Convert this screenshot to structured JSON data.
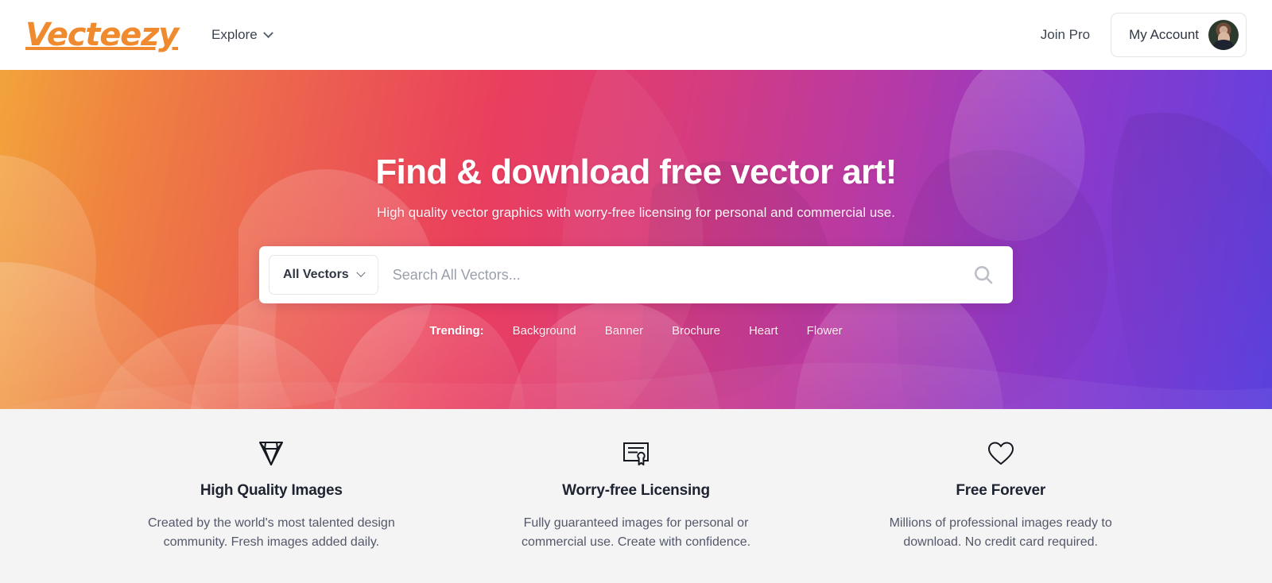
{
  "brand": {
    "logo_text": "Vecteezy",
    "logo_color": "#f08a2e"
  },
  "header": {
    "explore_label": "Explore",
    "join_pro_label": "Join Pro",
    "account_label": "My Account"
  },
  "hero": {
    "title": "Find & download free vector art!",
    "subtitle": "High quality vector graphics with worry-free licensing for personal and commercial use.",
    "gradient_from": "#f2a33c",
    "gradient_mid": "#ea3e5e",
    "gradient_to": "#5b42e0"
  },
  "search": {
    "category_value": "All Vectors",
    "placeholder": "Search All Vectors...",
    "input_value": ""
  },
  "trending": {
    "label": "Trending:",
    "links": [
      {
        "label": "Background"
      },
      {
        "label": "Banner"
      },
      {
        "label": "Brochure"
      },
      {
        "label": "Heart"
      },
      {
        "label": "Flower"
      }
    ]
  },
  "features": {
    "background": "#f4f4f5",
    "items": [
      {
        "icon": "diamond-icon",
        "title": "High Quality Images",
        "description": "Created by the world's most talented design community. Fresh images added daily."
      },
      {
        "icon": "certificate-icon",
        "title": "Worry-free Licensing",
        "description": "Fully guaranteed images for personal or commercial use. Create with confidence."
      },
      {
        "icon": "heart-icon",
        "title": "Free Forever",
        "description": "Millions of professional images ready to download. No credit card required."
      }
    ]
  }
}
